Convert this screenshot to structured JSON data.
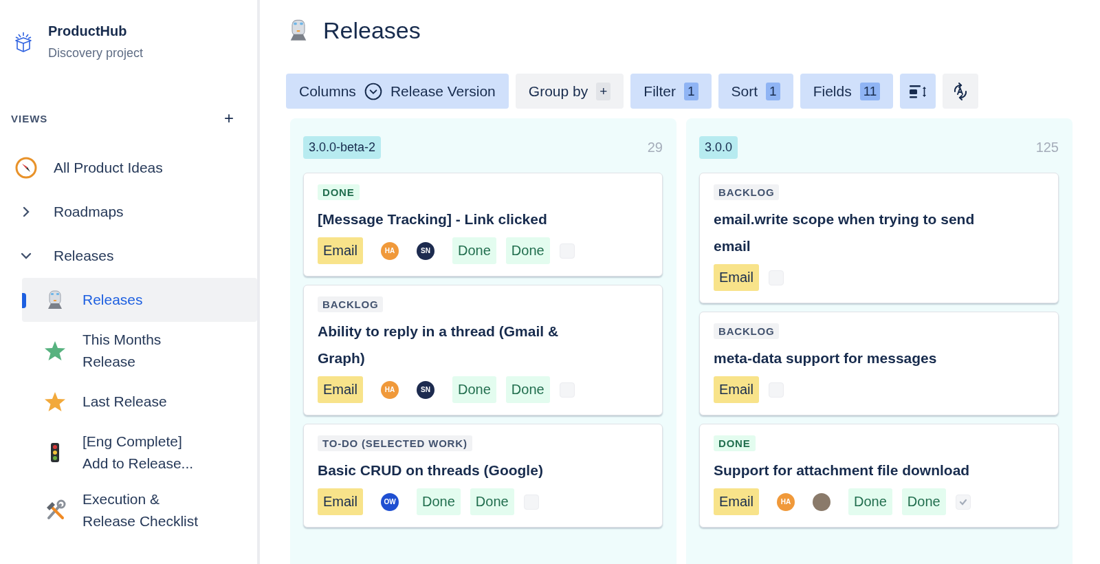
{
  "project": {
    "name": "ProductHub",
    "subtitle": "Discovery project"
  },
  "views": {
    "heading": "VIEWS",
    "add": "+",
    "items": [
      {
        "label": "All Product Ideas",
        "kind": "compass",
        "selected": false
      },
      {
        "label": "Roadmaps",
        "kind": "folder",
        "expanded": false,
        "selected": false
      },
      {
        "label": "Releases",
        "kind": "folder",
        "expanded": true,
        "selected": false,
        "children": [
          {
            "label": "Releases",
            "kind": "train",
            "selected": true
          },
          {
            "label": "This Months Release",
            "kind": "star",
            "color": "#57b27f",
            "selected": false
          },
          {
            "label": "Last Release",
            "kind": "star",
            "color": "#f2a93b",
            "selected": false
          },
          {
            "label": "[Eng Complete] Add to Release...",
            "kind": "traffic",
            "selected": false
          },
          {
            "label": "Execution & Release Checklist",
            "kind": "tools",
            "selected": false
          }
        ]
      }
    ]
  },
  "page": {
    "title": "Releases"
  },
  "toolbar": [
    {
      "kind": "columns",
      "label": "Columns",
      "value": "Release Version",
      "active": true
    },
    {
      "kind": "add",
      "label": "Group by",
      "badge": "+",
      "active": false
    },
    {
      "kind": "count",
      "label": "Filter",
      "badge": "1",
      "active": true
    },
    {
      "kind": "count",
      "label": "Sort",
      "badge": "1",
      "active": true
    },
    {
      "kind": "count",
      "label": "Fields",
      "badge": "11",
      "active": true
    },
    {
      "kind": "density",
      "active": true
    },
    {
      "kind": "autosort",
      "active": false
    }
  ],
  "columns": [
    {
      "version": "3.0.0-beta-2",
      "count": "29",
      "cards": [
        {
          "status": "DONE",
          "kind": "done",
          "title": "[Message Tracking] - Link clicked",
          "tag": "Email",
          "avatars": [
            {
              "kind": "initials",
              "initials": "HA",
              "color": "#f0993a"
            },
            {
              "kind": "initials",
              "initials": "SN",
              "color": "#1d2b4f"
            }
          ],
          "fields": [
            "Done",
            "Done"
          ],
          "checked": false
        },
        {
          "status": "BACKLOG",
          "kind": "backlog",
          "title": "Ability to reply in a thread (Gmail & Graph)",
          "tag": "Email",
          "avatars": [
            {
              "kind": "initials",
              "initials": "HA",
              "color": "#f0993a"
            },
            {
              "kind": "initials",
              "initials": "SN",
              "color": "#1d2b4f"
            }
          ],
          "fields": [
            "Done",
            "Done"
          ],
          "checked": false
        },
        {
          "status": "TO-DO (SELECTED WORK)",
          "kind": "backlog",
          "title": "Basic CRUD on threads (Google)",
          "tag": "Email",
          "avatars": [
            {
              "kind": "initials",
              "initials": "OW",
              "color": "#1f4fd1"
            }
          ],
          "fields": [
            "Done",
            "Done"
          ],
          "checked": false
        }
      ]
    },
    {
      "version": "3.0.0",
      "count": "125",
      "cards": [
        {
          "status": "BACKLOG",
          "kind": "backlog",
          "title": "email.write scope when trying to send email",
          "tag": "Email",
          "checked": false
        },
        {
          "status": "BACKLOG",
          "kind": "backlog",
          "title": "meta-data support for messages",
          "tag": "Email",
          "checked": false
        },
        {
          "status": "DONE",
          "kind": "done",
          "title": "Support for attachment file download",
          "tag": "Email",
          "avatars": [
            {
              "kind": "initials",
              "initials": "HA",
              "color": "#f0993a"
            },
            {
              "kind": "photo"
            }
          ],
          "fields": [
            "Done",
            "Done"
          ],
          "checked": true
        }
      ]
    }
  ]
}
